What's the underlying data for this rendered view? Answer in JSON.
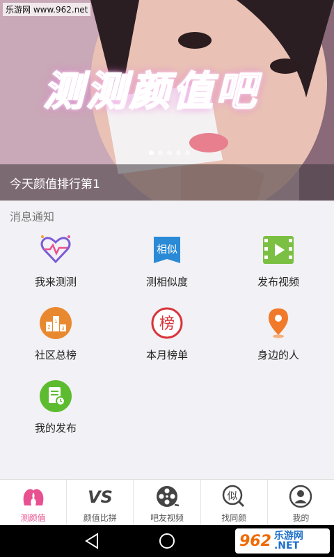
{
  "status_bar": {
    "watermark": "乐游网 www.962.net"
  },
  "banner": {
    "overlay_title": "测测颜值吧",
    "caption": "今天颜值排行第1",
    "dots_count": 5,
    "active_dot": 1
  },
  "section": {
    "title": "消息通知"
  },
  "features": [
    {
      "label": "我来测测",
      "icon": "heart-pulse-icon"
    },
    {
      "label": "测相似度",
      "icon": "similar-bookmark-icon",
      "icon_text": "相似"
    },
    {
      "label": "发布视频",
      "icon": "video-film-icon"
    },
    {
      "label": "社区总榜",
      "icon": "podium-icon"
    },
    {
      "label": "本月榜单",
      "icon": "ranking-seal-icon",
      "icon_text": "榜"
    },
    {
      "label": "身边的人",
      "icon": "location-pin-icon"
    },
    {
      "label": "我的发布",
      "icon": "my-posts-icon"
    }
  ],
  "bottom_nav": [
    {
      "label": "测颜值",
      "icon": "faces-icon",
      "active": true
    },
    {
      "label": "颜值比拼",
      "icon": "versus-icon",
      "icon_text": "VS"
    },
    {
      "label": "吧友视频",
      "icon": "film-reel-icon"
    },
    {
      "label": "找同颜",
      "icon": "find-similar-icon",
      "icon_text": "似"
    },
    {
      "label": "我的",
      "icon": "user-profile-icon"
    }
  ],
  "system_nav": {
    "logo_num": "962",
    "logo_text": "乐游网",
    "logo_net": ".NET"
  },
  "colors": {
    "accent": "#e8508f",
    "icon_orange": "#e9892f",
    "icon_green": "#7bc043",
    "icon_blue": "#2a8ad6",
    "icon_red": "#d8343a"
  }
}
